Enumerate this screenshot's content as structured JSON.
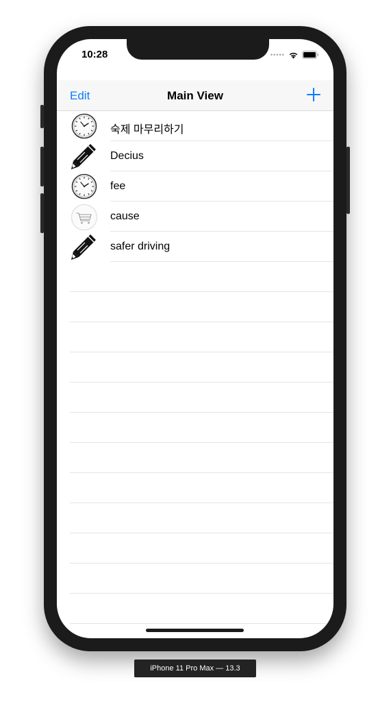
{
  "status_bar": {
    "time": "10:28"
  },
  "navbar": {
    "edit_label": "Edit",
    "title": "Main View",
    "add_icon": "plus-icon"
  },
  "rows": [
    {
      "label": "숙제 마무리하기",
      "icon": "clock-icon"
    },
    {
      "label": "Decius",
      "icon": "pencil-icon"
    },
    {
      "label": "fee",
      "icon": "clock-icon"
    },
    {
      "label": "cause",
      "icon": "cart-icon"
    },
    {
      "label": "safer driving",
      "icon": "pencil-icon"
    }
  ],
  "device_label": "iPhone 11 Pro Max — 13.3",
  "colors": {
    "accent": "#0a7cff",
    "bezel": "#1b1b1b",
    "separator": "#e4e4e4"
  }
}
